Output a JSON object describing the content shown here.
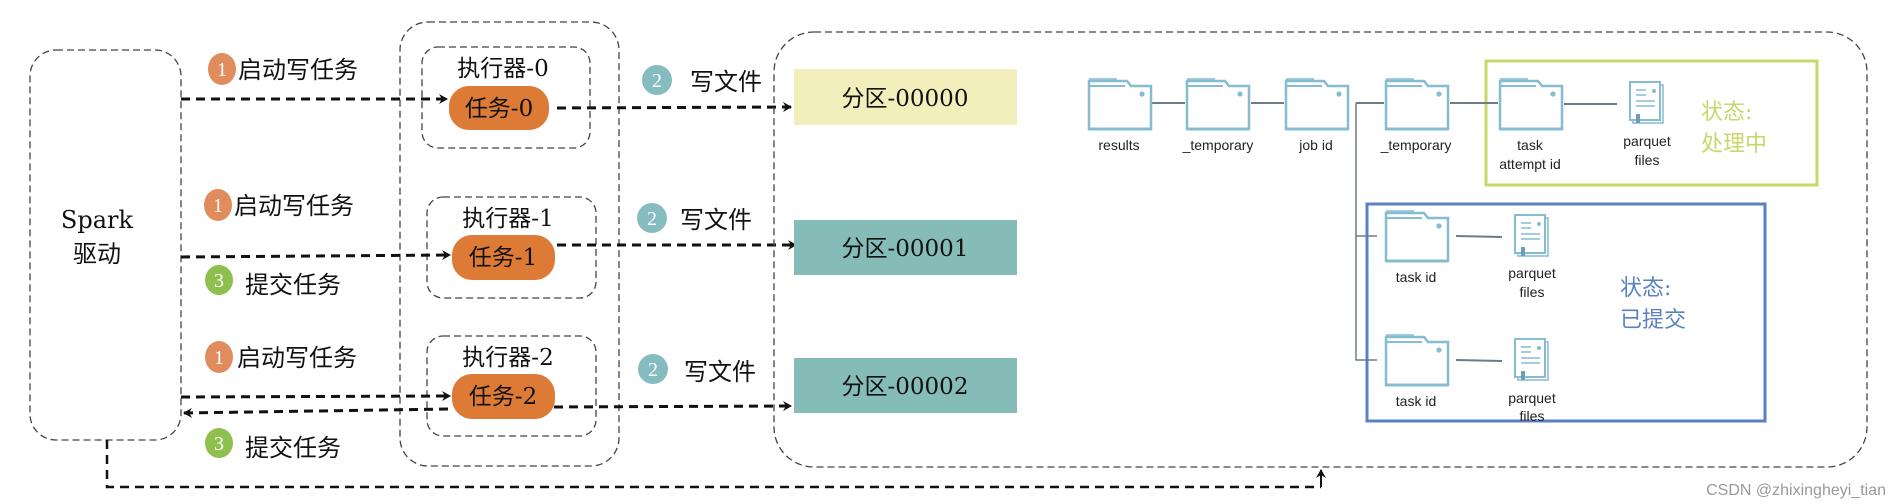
{
  "colors": {
    "teal": "#85bcb8",
    "orange": "#dd7a35",
    "partition_pending": "#f3efbd",
    "step1": "#e08c5c",
    "step2": "#85bcc0",
    "step3": "#8fbf4f",
    "processing": "#c9d66a",
    "committed": "#5b82c0",
    "folder": "#86bcd0"
  },
  "driver": {
    "line1": "Spark",
    "line2": "驱动"
  },
  "steps": {
    "start": {
      "num": "1",
      "label": "启动写任务"
    },
    "write": {
      "num": "2",
      "label": "写文件"
    },
    "commit": {
      "num": "3",
      "label": "提交任务"
    }
  },
  "executors": [
    {
      "name": "执行器-0",
      "task": "任务-0"
    },
    {
      "name": "执行器-1",
      "task": "任务-1"
    },
    {
      "name": "执行器-2",
      "task": "任务-2"
    }
  ],
  "partitions": [
    "分区-00000",
    "分区-00001",
    "分区-00002"
  ],
  "tree": {
    "path": [
      "results",
      "_temporary",
      "job id",
      "_temporary"
    ],
    "attempt": {
      "line1": "task",
      "line2": "attempt id"
    },
    "files": {
      "line1": "parquet",
      "line2": "files"
    },
    "task_id": "task id",
    "processing": {
      "line1": "状态:",
      "line2": "处理中"
    },
    "committed": {
      "line1": "状态:",
      "line2": "已提交"
    }
  },
  "watermark": "CSDN @zhixingheyi_tian"
}
